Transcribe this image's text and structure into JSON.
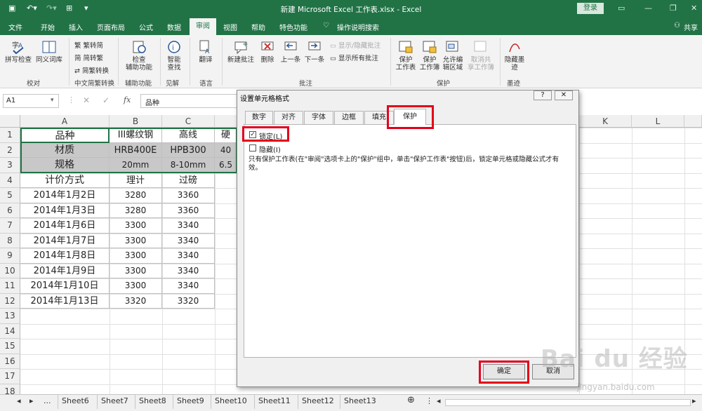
{
  "window": {
    "title": "新建 Microsoft Excel 工作表.xlsx  -  Excel",
    "login": "登录"
  },
  "tabs": [
    "文件",
    "开始",
    "插入",
    "页面布局",
    "公式",
    "数据",
    "审阅",
    "视图",
    "帮助",
    "特色功能"
  ],
  "active_tab": "审阅",
  "tell_me": "操作说明搜索",
  "share": "共享",
  "ribbon": {
    "spell": "拼写检查",
    "thesaurus": "同义词库",
    "group_proofing": "校对",
    "to_trad": "繁转简",
    "to_simp": "简转繁",
    "convert": "简繁转换",
    "group_chinese": "中文简繁转换",
    "access1": "检查",
    "access2": "辅助功能",
    "group_access": "辅助功能",
    "smart1": "智能",
    "smart2": "查找",
    "group_insights": "见解",
    "translate": "翻译",
    "group_lang": "语言",
    "new_comment": "新建批注",
    "delete": "删除",
    "prev": "上一条",
    "next": "下一条",
    "show_hide": "显示/隐藏批注",
    "show_all": "显示所有批注",
    "group_comments": "批注",
    "protect_sheet1": "保护",
    "protect_sheet2": "工作表",
    "protect_wb1": "保护",
    "protect_wb2": "工作簿",
    "allow1": "允许编",
    "allow2": "辑区域",
    "unshare1": "取消共",
    "unshare2": "享工作簿",
    "group_protect": "保护",
    "ink1": "隐藏墨",
    "ink2": "迹",
    "group_ink": "墨迹"
  },
  "formula": {
    "namebox": "A1",
    "fx": "fx",
    "content": "品种"
  },
  "columns": [
    "A",
    "B",
    "C",
    "K",
    "L"
  ],
  "rows": [
    "1",
    "2",
    "3",
    "4",
    "5",
    "6",
    "7",
    "8",
    "9",
    "10",
    "11",
    "12",
    "13",
    "14",
    "15",
    "16",
    "17",
    "18"
  ],
  "table": [
    [
      "品种",
      "III螺纹钢",
      "高线",
      "硬"
    ],
    [
      "材质",
      "HRB400E",
      "HPB300",
      "40"
    ],
    [
      "规格",
      "20mm",
      "8-10mm",
      "6.5"
    ],
    [
      "计价方式",
      "理计",
      "过磅",
      ""
    ],
    [
      "2014年1月2日",
      "3280",
      "3360",
      ""
    ],
    [
      "2014年1月3日",
      "3280",
      "3360",
      ""
    ],
    [
      "2014年1月6日",
      "3300",
      "3340",
      ""
    ],
    [
      "2014年1月7日",
      "3300",
      "3340",
      ""
    ],
    [
      "2014年1月8日",
      "3300",
      "3340",
      ""
    ],
    [
      "2014年1月9日",
      "3300",
      "3340",
      ""
    ],
    [
      "2014年1月10日",
      "3300",
      "3340",
      ""
    ],
    [
      "2014年1月13日",
      "3320",
      "3320",
      ""
    ]
  ],
  "dialog": {
    "title": "设置单元格格式",
    "help": "?",
    "close": "✕",
    "tabs": [
      "数字",
      "对齐",
      "字体",
      "边框",
      "填充",
      "保护"
    ],
    "active_tab": "保护",
    "locked": "锁定(L)",
    "hidden": "隐藏(I)",
    "note": "只有保护工作表(在\"审阅\"选项卡上的\"保护\"组中，单击\"保护工作表\"按钮)后，锁定单元格或隐藏公式才有效。",
    "ok": "确定",
    "cancel": "取消"
  },
  "sheets": [
    "Sheet6",
    "Sheet7",
    "Sheet8",
    "Sheet9",
    "Sheet10",
    "Sheet11",
    "Sheet12",
    "Sheet13"
  ],
  "sheet_nav": {
    "ellipsis": "...",
    "add": "⊕"
  },
  "watermark": {
    "brand": "Bai du 经验",
    "url": "jingyan.baidu.com"
  },
  "colors": {
    "excel_green": "#217346",
    "highlight_red": "#e3001b",
    "header_fill": "#c8c8c8"
  }
}
